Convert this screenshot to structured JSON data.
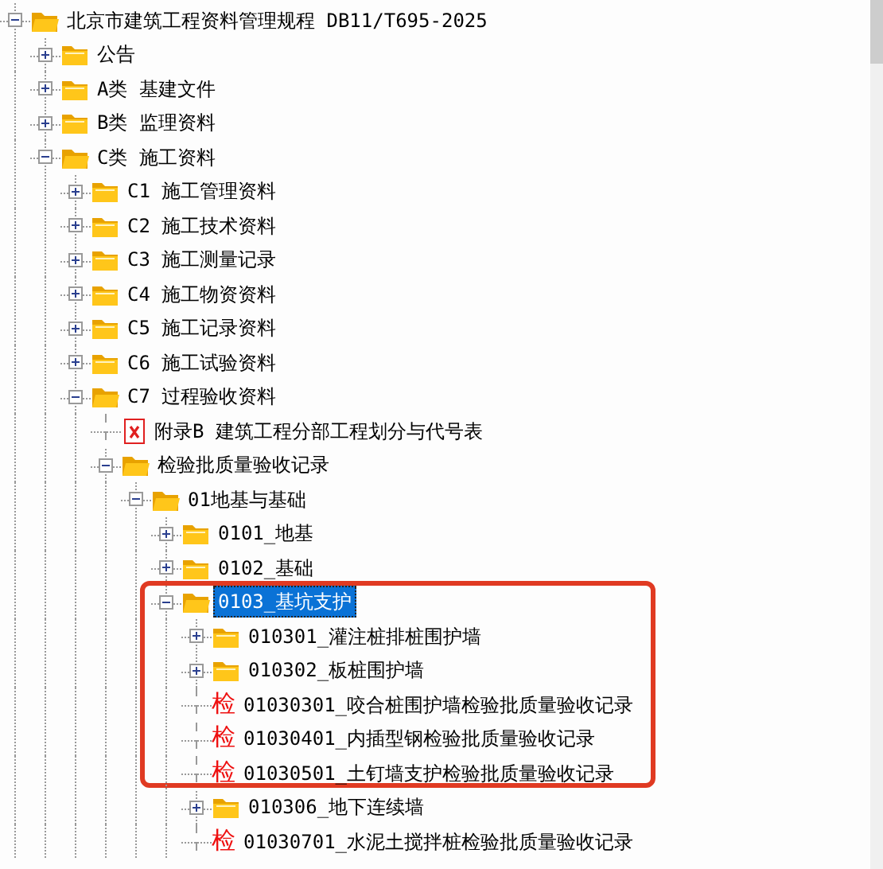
{
  "tree": [
    {
      "kind": "folder",
      "label": "北京市建筑工程资料管理规程 DB11/T695-2025",
      "expanded": true,
      "children": [
        {
          "kind": "folder",
          "label": "公告",
          "expanded": false
        },
        {
          "kind": "folder",
          "label": "A类 基建文件",
          "expanded": false
        },
        {
          "kind": "folder",
          "label": "B类 监理资料",
          "expanded": false
        },
        {
          "kind": "folder",
          "label": "C类 施工资料",
          "expanded": true,
          "children": [
            {
              "kind": "folder",
              "label": "C1 施工管理资料",
              "expanded": false
            },
            {
              "kind": "folder",
              "label": "C2 施工技术资料",
              "expanded": false
            },
            {
              "kind": "folder",
              "label": "C3 施工测量记录",
              "expanded": false
            },
            {
              "kind": "folder",
              "label": "C4 施工物资资料",
              "expanded": false
            },
            {
              "kind": "folder",
              "label": "C5 施工记录资料",
              "expanded": false
            },
            {
              "kind": "folder",
              "label": "C6 施工试验资料",
              "expanded": false
            },
            {
              "kind": "folder",
              "label": "C7 过程验收资料",
              "expanded": true,
              "children": [
                {
                  "kind": "sheet",
                  "label": "附录B 建筑工程分部工程划分与代号表"
                },
                {
                  "kind": "folder",
                  "label": "检验批质量验收记录",
                  "expanded": true,
                  "children": [
                    {
                      "kind": "folder",
                      "label": "01地基与基础",
                      "expanded": true,
                      "children": [
                        {
                          "kind": "folder",
                          "label": "0101_地基",
                          "expanded": false
                        },
                        {
                          "kind": "folder",
                          "label": "0102_基础",
                          "expanded": false
                        },
                        {
                          "kind": "folder",
                          "label": "0103_基坑支护",
                          "expanded": true,
                          "selected": true,
                          "children": [
                            {
                              "kind": "folder",
                              "label": "010301_灌注桩排桩围护墙",
                              "expanded": false
                            },
                            {
                              "kind": "folder",
                              "label": "010302_板桩围护墙",
                              "expanded": false
                            },
                            {
                              "kind": "form",
                              "icon_text": "检",
                              "label": "01030301_咬合桩围护墙检验批质量验收记录"
                            },
                            {
                              "kind": "form",
                              "icon_text": "检",
                              "label": "01030401_内插型钢检验批质量验收记录"
                            },
                            {
                              "kind": "form",
                              "icon_text": "检",
                              "label": "01030501_土钉墙支护检验批质量验收记录"
                            },
                            {
                              "kind": "folder",
                              "label": "010306_地下连续墙",
                              "expanded": false
                            },
                            {
                              "kind": "form",
                              "icon_text": "检",
                              "label": "01030701_水泥土搅拌桩检验批质量验收记录"
                            }
                          ]
                        }
                      ]
                    }
                  ]
                }
              ]
            }
          ]
        }
      ]
    }
  ]
}
